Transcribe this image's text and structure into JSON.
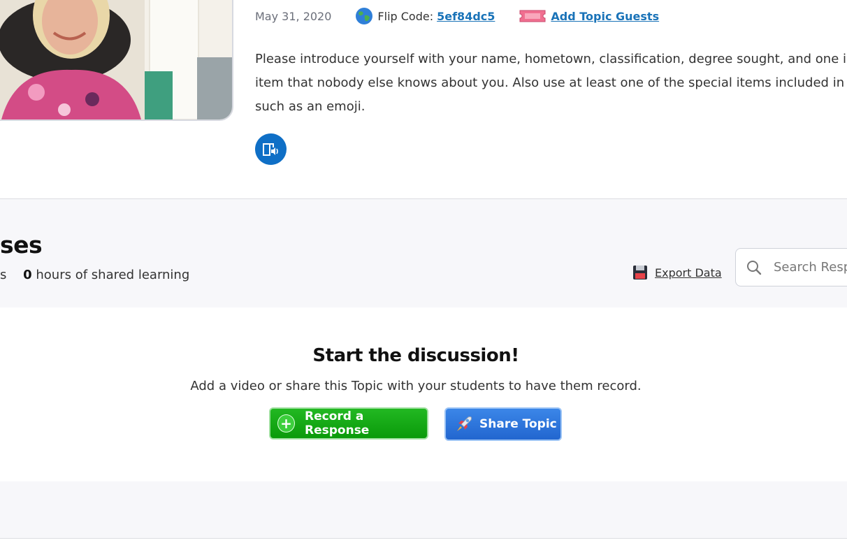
{
  "topic": {
    "date": "May 31, 2020",
    "flip_code_label": "Flip Code:",
    "flip_code": "5ef84dc5",
    "add_guests_label": "Add Topic Guests",
    "description_lines": [
      "Please introduce yourself with your name,  hometown,  classification, degree sought, and one in",
      "item that nobody else knows about you.  Also use  at least one of the special items included in f",
      "such as an emoji."
    ]
  },
  "responses": {
    "title": "ses",
    "stats_prefix": "s",
    "hours_value": "0",
    "hours_label": "hours of shared learning",
    "export_label": "Export Data",
    "search_placeholder": "Search Responses"
  },
  "discussion": {
    "title": "Start the discussion!",
    "subtitle": "Add a video or share this Topic with your students to have them record.",
    "record_label": "Record a Response",
    "record_icon": "+",
    "share_label": "Share Topic"
  },
  "colors": {
    "link": "#1a73b8",
    "audio_button": "#0f6fc6",
    "record_button": "#0fa30f",
    "share_button": "#2a70d8",
    "band_bg": "#f7f7fa"
  },
  "icons": [
    "globe-icon",
    "guest-ticket-icon",
    "immersive-reader-icon",
    "floppy-disk-icon",
    "search-icon",
    "plus-icon",
    "rocket-icon"
  ]
}
